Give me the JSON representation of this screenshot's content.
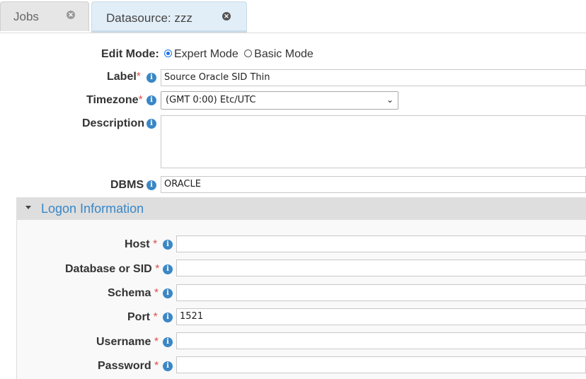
{
  "tabs": [
    {
      "label": "Jobs",
      "active": false
    },
    {
      "label": "Datasource: zzz",
      "active": true
    }
  ],
  "form": {
    "edit_mode_label": "Edit Mode:",
    "edit_mode_options": [
      {
        "label": "Expert Mode",
        "selected": true
      },
      {
        "label": "Basic Mode",
        "selected": false
      }
    ],
    "label_label": "Label",
    "label_value": "Source Oracle SID Thin",
    "timezone_label": "Timezone",
    "timezone_value": "(GMT 0:00) Etc/UTC",
    "description_label": "Description",
    "description_value": "",
    "dbms_label": "DBMS",
    "dbms_value": "ORACLE"
  },
  "logon": {
    "title": "Logon Information",
    "fields": [
      {
        "label": "Host",
        "value": ""
      },
      {
        "label": "Database or SID",
        "value": ""
      },
      {
        "label": "Schema",
        "value": ""
      },
      {
        "label": "Port",
        "value": "1521"
      },
      {
        "label": "Username",
        "value": ""
      },
      {
        "label": "Password",
        "value": ""
      }
    ]
  },
  "required_marker": "*",
  "info_glyph": "i",
  "colors": {
    "accent": "#3a87c6",
    "required": "#d9534f",
    "active_tab": "#e2eef7",
    "section_header": "#dedede"
  }
}
